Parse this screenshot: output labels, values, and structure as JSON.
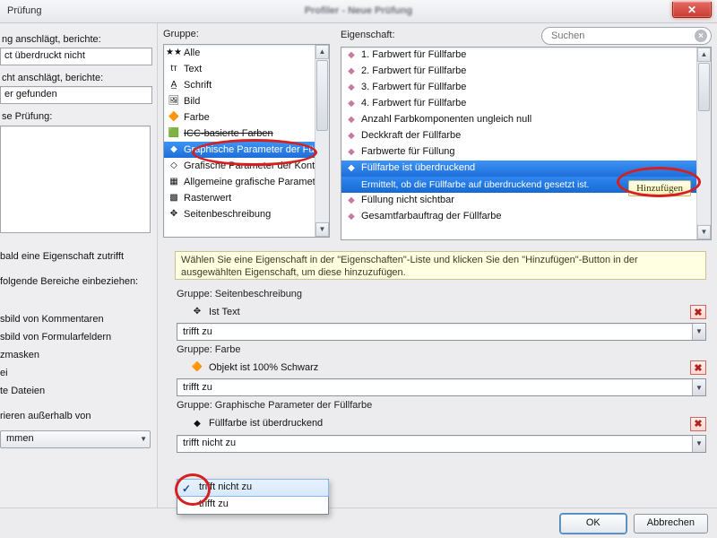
{
  "window": {
    "title": "Prüfung",
    "shadow_title": "Profiler - Neue Prüfung",
    "close_glyph": "✕"
  },
  "left_top": {
    "lbl1": "ng anschlägt, berichte:",
    "val1": "ct überdruckt nicht",
    "lbl2": "cht anschlägt, berichte:",
    "val2": "er gefunden",
    "lbl3": "se Prüfung:"
  },
  "group_pane": {
    "label": "Gruppe:",
    "items": [
      {
        "name": "all",
        "label": "Alle",
        "glyph": "★★"
      },
      {
        "name": "text",
        "label": "Text",
        "glyph": "tт"
      },
      {
        "name": "schrift",
        "label": "Schrift",
        "glyph": "A̲"
      },
      {
        "name": "bild",
        "label": "Bild",
        "glyph": "🖼"
      },
      {
        "name": "farbe",
        "label": "Farbe",
        "glyph": "🔶"
      },
      {
        "name": "icc",
        "label": "ICC-basierte Farben",
        "glyph": "🟩",
        "strike": true
      },
      {
        "name": "gp-fill",
        "label": "Graphische Parameter der Füllf",
        "glyph": "◆",
        "sel": true
      },
      {
        "name": "gp-kontur",
        "label": "Grafische Parameter der Kontu",
        "glyph": "◇"
      },
      {
        "name": "gp-allg",
        "label": "Allgemeine grafische Paramete",
        "glyph": "▦"
      },
      {
        "name": "raster",
        "label": "Rasterwert",
        "glyph": "▩"
      },
      {
        "name": "seitenb",
        "label": "Seitenbeschreibung",
        "glyph": "✥"
      }
    ]
  },
  "prop_pane": {
    "label": "Eigenschaft:",
    "search_placeholder": "Suchen",
    "add_label": "Hinzufügen",
    "items": [
      {
        "label": "1. Farbwert für Füllfarbe"
      },
      {
        "label": "2. Farbwert für Füllfarbe"
      },
      {
        "label": "3. Farbwert für Füllfarbe"
      },
      {
        "label": "4. Farbwert für Füllfarbe"
      },
      {
        "label": "Anzahl Farbkomponenten ungleich null"
      },
      {
        "label": "Deckkraft der Füllfarbe"
      },
      {
        "label": "Farbwerte für Füllung"
      },
      {
        "label": "Füllfarbe ist überdruckend",
        "sel": true,
        "hint": "Ermittelt, ob die Füllfarbe auf überdruckend gesetzt ist."
      },
      {
        "label": "Füllung nicht sichtbar"
      },
      {
        "label": "Gesamtfarbauftrag der Füllfarbe"
      }
    ]
  },
  "help_text": "Wählen Sie eine Eigenschaft in der \"Eigenschaften\"-Liste und klicken Sie den \"Hinzufügen\"-Button in der ausgewählten Eigenschaft, um diese hinzuzufügen.",
  "rules": [
    {
      "group_label": "Gruppe:  Seitenbeschreibung",
      "item": {
        "glyph": "✥",
        "label": "Ist Text"
      },
      "combo_value": "trifft zu"
    },
    {
      "group_label": "Gruppe:  Farbe",
      "item": {
        "glyph": "🔶",
        "label": "Objekt ist 100% Schwarz"
      },
      "combo_value": "trifft zu"
    },
    {
      "group_label": "Gruppe:  Graphische Parameter der Füllfarbe",
      "item": {
        "glyph": "◆",
        "label": "Füllfarbe ist überdruckend"
      },
      "combo_value": "trifft nicht zu"
    }
  ],
  "dropdown": {
    "selected_glyph": "✓",
    "opt_sel": "trifft nicht zu",
    "opt_other": "trifft zu"
  },
  "left_lower": {
    "l1": "bald eine Eigenschaft zutrifft",
    "l2": "folgende Bereiche einbeziehen:",
    "c1": "sbild von Kommentaren",
    "c2": "sbild von Formularfeldern",
    "c3": "zmasken",
    "c4": "ei",
    "c5": "te Dateien",
    "c6": "rieren außerhalb von",
    "select_val": "mmen"
  },
  "buttons": {
    "ok": "OK",
    "cancel": "Abbrechen"
  },
  "icons": {
    "prop_glyph": "◆"
  }
}
